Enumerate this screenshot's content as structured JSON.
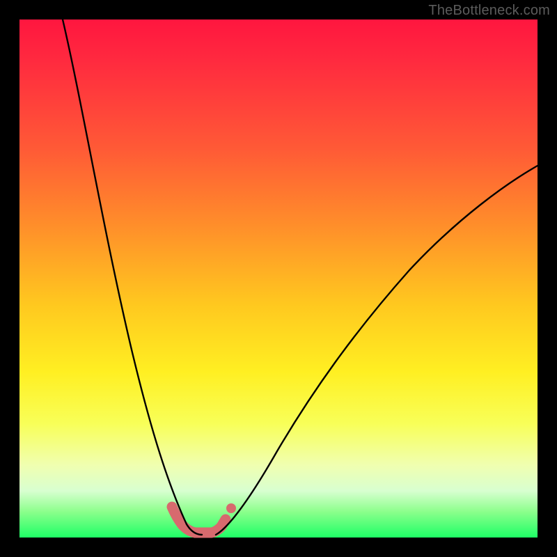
{
  "watermark": "TheBottleneck.com",
  "chart_data": {
    "type": "line",
    "title": "",
    "xlabel": "",
    "ylabel": "",
    "xlim": [
      0,
      100
    ],
    "ylim": [
      0,
      100
    ],
    "series": [
      {
        "name": "left-curve",
        "x": [
          8,
          10,
          12,
          14,
          16,
          18,
          20,
          22,
          24,
          26,
          28,
          30,
          32,
          33
        ],
        "y": [
          100,
          90,
          80,
          70,
          60,
          50,
          41,
          33,
          25,
          18,
          12,
          7,
          3,
          1
        ]
      },
      {
        "name": "right-curve",
        "x": [
          38,
          40,
          44,
          48,
          52,
          56,
          60,
          66,
          72,
          80,
          88,
          96,
          100
        ],
        "y": [
          1,
          3,
          8,
          14,
          21,
          28,
          34,
          42,
          49,
          57,
          64,
          69,
          72
        ]
      },
      {
        "name": "highlight-band",
        "x": [
          30,
          31,
          32,
          33,
          34,
          35,
          36,
          37,
          38,
          39
        ],
        "y": [
          5,
          3,
          1.5,
          1,
          1,
          1,
          1,
          1.5,
          2.5,
          4
        ],
        "style": "thick-pink"
      }
    ],
    "colors": {
      "curve": "#000000",
      "highlight": "#d76a6e",
      "gradient_top": "#ff163f",
      "gradient_bottom": "#1eff66"
    }
  }
}
